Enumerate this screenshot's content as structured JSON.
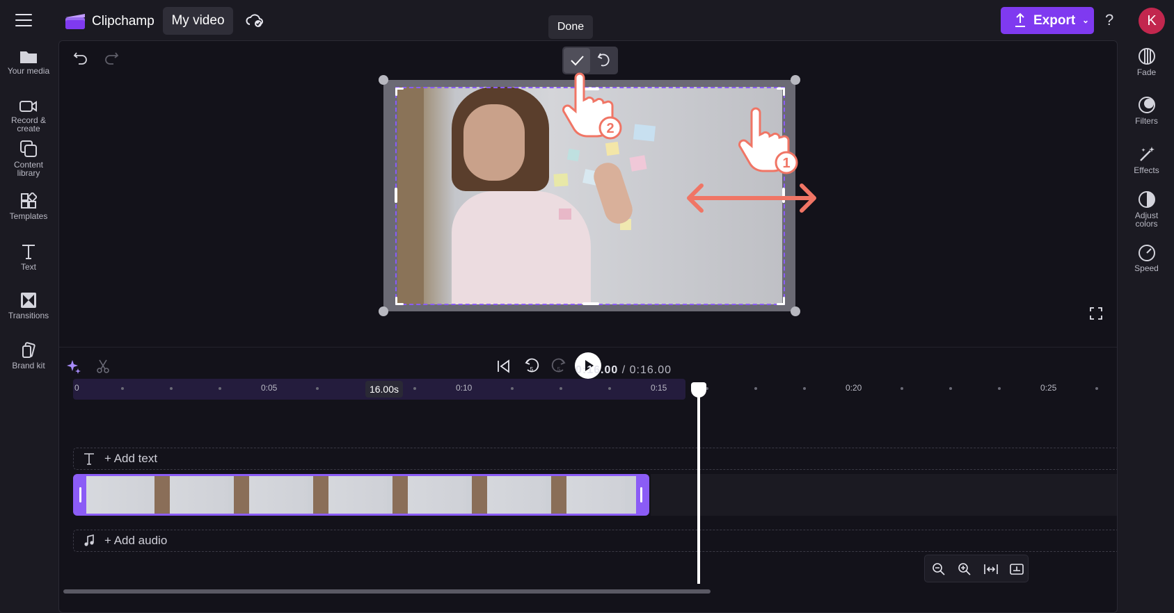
{
  "app": {
    "name": "Clipchamp",
    "video_name": "My video"
  },
  "header": {
    "export_label": "Export",
    "help_label": "?",
    "avatar_initial": "K"
  },
  "left_sidebar": [
    {
      "label": "Your media"
    },
    {
      "label": "Record &\ncreate"
    },
    {
      "label": "Content\nlibrary"
    },
    {
      "label": "Templates"
    },
    {
      "label": "Text"
    },
    {
      "label": "Transitions"
    },
    {
      "label": "Brand kit"
    }
  ],
  "right_sidebar": [
    {
      "label": "Fade"
    },
    {
      "label": "Filters"
    },
    {
      "label": "Effects"
    },
    {
      "label": "Adjust\ncolors"
    },
    {
      "label": "Speed"
    }
  ],
  "crop": {
    "done_tooltip": "Done",
    "step1": "1",
    "step2": "2"
  },
  "playback": {
    "current": "0:16.00",
    "separator": " / ",
    "total": "0:16.00"
  },
  "timeline": {
    "ticks": [
      "0",
      "0:05",
      "0:10",
      "0:15",
      "0:20",
      "0:25"
    ],
    "marker": "16.00s",
    "add_text": "+ Add text",
    "add_audio": "+ Add audio"
  },
  "colors": {
    "accent": "#7f3af0",
    "clip_border": "#8b5cf6",
    "annotation": "#f07565",
    "avatar": "#c2274e"
  }
}
